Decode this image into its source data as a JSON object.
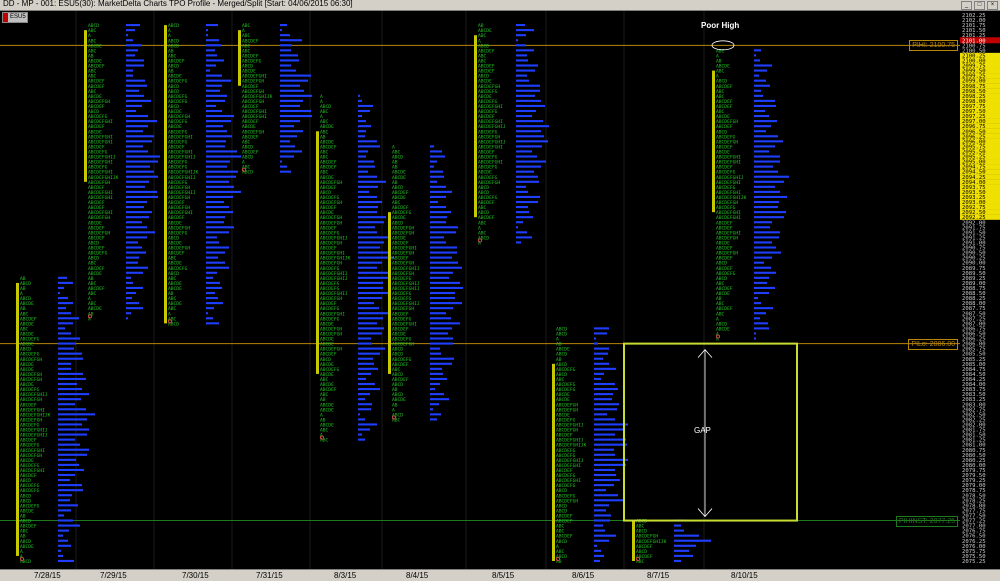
{
  "window": {
    "title": "DD - MP - 001: ESU5(30): MarketDelta Charts TPO Profile - Merged/Split [Start: 04/06/2015 06:30]",
    "badge_label": "ESU5"
  },
  "colors": {
    "tpo_letters": "#22c322",
    "volume_bars": "#1f3fff",
    "value_area_bar": "#c8c800",
    "reference_line": "#b8860b",
    "gap_box": "#c8dc32",
    "price_highlight": "#f0e000",
    "current_price": "#c00000"
  },
  "price_scale": {
    "top_price": 2102.25,
    "bottom_price": 2075.25,
    "step": 0.25,
    "highlighted_range": [
      2092.25,
      2100.25
    ],
    "current_price_label": "2101.00"
  },
  "reference_lines": [
    {
      "label": "PIHI: 2100.75",
      "price": 2100.75
    },
    {
      "label": "PILo: 2086.00",
      "price": 2086.0
    },
    {
      "label": "PIHINST: 2077.25",
      "price": 2077.25
    }
  ],
  "annotations": {
    "poor_high": "Poor High",
    "gap": "GAP"
  },
  "date_axis": [
    "7/28/15",
    "7/29/15",
    "7/30/15",
    "7/31/15",
    "8/3/15",
    "8/4/15",
    "8/5/15",
    "8/6/15",
    "8/7/15",
    "8/10/15"
  ],
  "profiles": [
    {
      "date": "7/28/15",
      "high": 2089.25,
      "low": 2075.25,
      "va_high": 2089.0,
      "va_low": 2075.5
    },
    {
      "date": "7/29/15",
      "high": 2101.75,
      "low": 2087.25,
      "va_high": 2101.5,
      "va_low": 2094.0
    },
    {
      "date": "7/30/15",
      "high": 2101.75,
      "low": 2087.0,
      "va_high": 2101.75,
      "va_low": 2087.0
    },
    {
      "date": "7/31/15",
      "high": 2101.75,
      "low": 2094.5,
      "va_high": 2101.5,
      "va_low": 2098.75
    },
    {
      "date": "8/3/15",
      "high": 2098.25,
      "low": 2081.25,
      "va_high": 2096.5,
      "va_low": 2084.5
    },
    {
      "date": "8/4/15",
      "high": 2095.75,
      "low": 2082.25,
      "va_high": 2092.5,
      "va_low": 2084.5
    },
    {
      "date": "8/5/15",
      "high": 2101.75,
      "low": 2091.0,
      "va_high": 2101.25,
      "va_low": 2092.25
    },
    {
      "date": "8/6/15",
      "high": 2086.75,
      "low": 2075.25,
      "va_high": 2085.0,
      "va_low": 2075.25
    },
    {
      "date": "8/7/15",
      "high": 2077.25,
      "low": 2075.25,
      "va_high": 2077.25,
      "va_low": 2075.25
    },
    {
      "date": "8/10/15",
      "high": 2100.5,
      "low": 2086.25,
      "va_high": 2099.5,
      "va_low": 2092.5
    }
  ]
}
